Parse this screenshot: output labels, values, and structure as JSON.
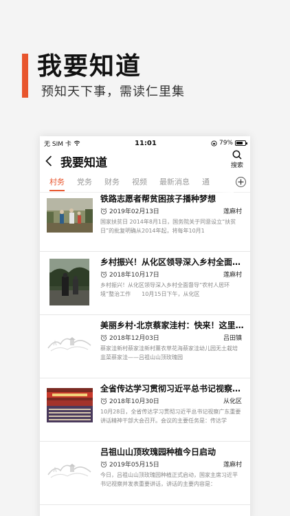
{
  "promo": {
    "title": "我要知道",
    "subtitle": "预知天下事，需读仁里集"
  },
  "status": {
    "carrier": "无 SIM 卡",
    "time": "11:01",
    "battery": "79%",
    "battery_level": 0.79
  },
  "nav": {
    "title": "我要知道",
    "search_label": "搜索"
  },
  "tabs": [
    "村务",
    "党务",
    "财务",
    "视频",
    "最新消息",
    "通"
  ],
  "active_tab": "村务",
  "items": [
    {
      "title": "铁路志愿者帮贫困孩子播种梦想",
      "date": "2019年02月13日",
      "source": "莲麻村",
      "summary": "国家扶贫日 2014年8月1日，国务院关于同意设立“扶贫日”的批复明确从2014年起，将每年10月1",
      "thumb": "volunteer-photo"
    },
    {
      "title": "乡村振兴！从化区领导深入乡村全面督导",
      "date": "2018年10月17日",
      "source": "莲麻村",
      "summary": "乡村振兴！从化区领导深入乡村全面督导“农村人居环境”整治工作　　10月15日下午，从化区",
      "thumb": "village-photo"
    },
    {
      "title": "美丽乡村·北京蔡家洼村：快来！这里的薰衣草",
      "date": "2018年12月03日",
      "source": "吕田镇",
      "summary": "蔡家洼新村蔡家洼新村薰衣草花海蔡家洼幼儿园无土栽培韭菜蔡家洼——吕祖山山顶玫瑰园",
      "thumb": "ink-landscape"
    },
    {
      "title": "全省传达学习贯彻习近平总书记视察广东重要讲话",
      "date": "2018年10月30日",
      "source": "从化区",
      "summary": "10月28日，全省传达学习贯彻习近平总书记视察广东重要讲话精神干部大会召开。会议的主要任务是：传达学",
      "thumb": "meeting-hall-photo"
    },
    {
      "title": "吕祖山山顶玫瑰园种植今日启动",
      "date": "2019年05月15日",
      "source": "莲麻村",
      "summary": "今日，吕祖山山顶玫瑰园种植正式启动，国家主席习近平书记视察并发表重要讲话，讲话的主要内容是：",
      "thumb": "ink-landscape"
    }
  ],
  "colors": {
    "accent": "#e8552d",
    "text": "#111111",
    "muted": "#888888"
  }
}
